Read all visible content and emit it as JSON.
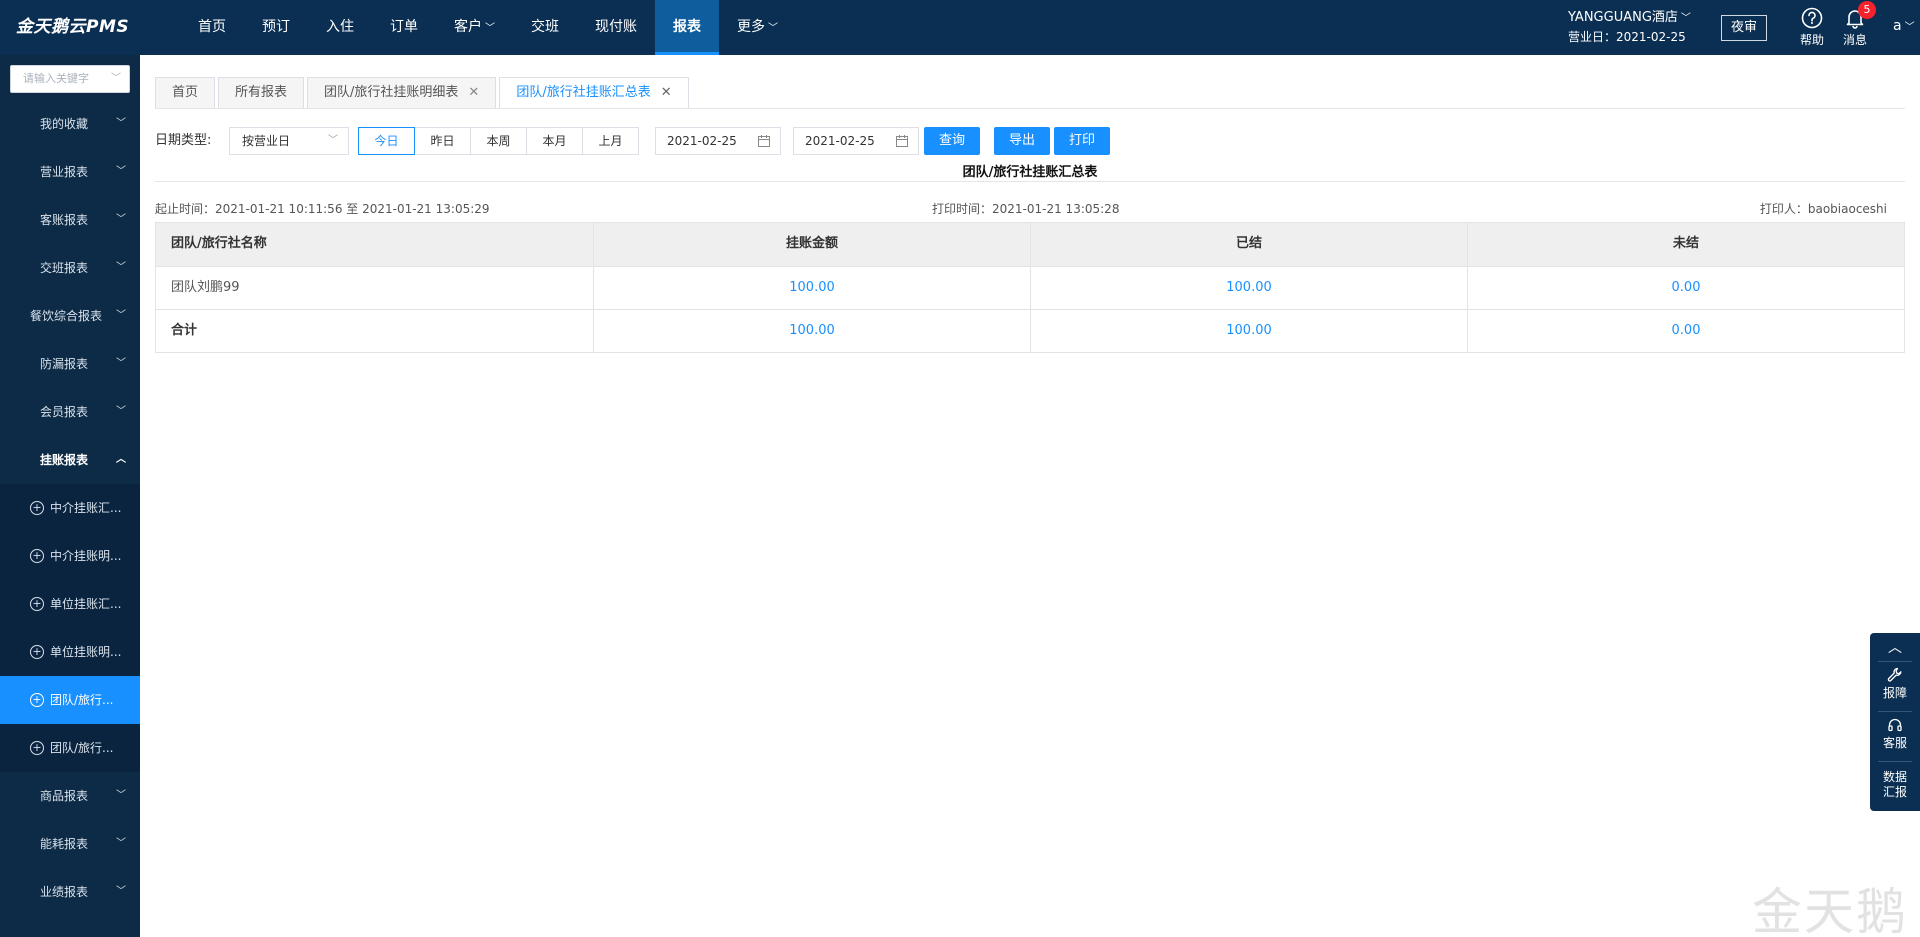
{
  "app": {
    "brand": "金天鹅云PMS"
  },
  "nav": {
    "items": [
      {
        "label": "首页",
        "has_menu": false
      },
      {
        "label": "预订",
        "has_menu": false
      },
      {
        "label": "入住",
        "has_menu": false
      },
      {
        "label": "订单",
        "has_menu": false
      },
      {
        "label": "客户",
        "has_menu": true
      },
      {
        "label": "交班",
        "has_menu": false
      },
      {
        "label": "现付账",
        "has_menu": false
      },
      {
        "label": "报表",
        "has_menu": false,
        "active": true
      },
      {
        "label": "更多",
        "has_menu": true
      }
    ]
  },
  "header": {
    "hotel_name": "YANGGUANG酒店",
    "business_date": "营业日：2021-02-25",
    "night_audit": "夜审",
    "help": "帮助",
    "messages": "消息",
    "message_count": "5",
    "user": "a"
  },
  "sidebar": {
    "search_placeholder": "请输入关键字",
    "items": [
      {
        "label": "我的收藏"
      },
      {
        "label": "营业报表"
      },
      {
        "label": "客账报表"
      },
      {
        "label": "交班报表"
      },
      {
        "label": "餐饮综合报表"
      },
      {
        "label": "防漏报表"
      },
      {
        "label": "会员报表"
      }
    ],
    "open_group": "挂账报表",
    "subitems": [
      {
        "label": "中介挂账汇..."
      },
      {
        "label": "中介挂账明..."
      },
      {
        "label": "单位挂账汇..."
      },
      {
        "label": "单位挂账明..."
      },
      {
        "label": "团队/旅行...",
        "active": true
      },
      {
        "label": "团队/旅行..."
      }
    ],
    "items_after": [
      {
        "label": "商品报表"
      },
      {
        "label": "能耗报表"
      },
      {
        "label": "业绩报表"
      }
    ]
  },
  "tabs": [
    {
      "label": "首页",
      "closable": false
    },
    {
      "label": "所有报表",
      "closable": false
    },
    {
      "label": "团队/旅行社挂账明细表",
      "closable": true
    },
    {
      "label": "团队/旅行社挂账汇总表",
      "closable": true,
      "active": true
    }
  ],
  "filters": {
    "date_type_label": "日期类型:",
    "date_type_value": "按营业日",
    "ranges": [
      "今日",
      "昨日",
      "本周",
      "本月",
      "上月"
    ],
    "active_range": "今日",
    "start_date": "2021-02-25",
    "end_date": "2021-02-25",
    "query": "查询",
    "export": "导出",
    "print": "打印"
  },
  "report": {
    "title": "团队/旅行社挂账汇总表",
    "period": "起止时间：2021-01-21 10:11:56 至 2021-01-21 13:05:29",
    "print_time": "打印时间：2021-01-21 13:05:28",
    "printer": "打印人：baobiaoceshi",
    "columns": [
      "团队/旅行社名称",
      "挂账金额",
      "已结",
      "未结"
    ],
    "rows": [
      {
        "name": "团队刘鹏99",
        "amount": "100.00",
        "settled": "100.00",
        "unsettled": "0.00"
      }
    ],
    "total": {
      "name": "合计",
      "amount": "100.00",
      "settled": "100.00",
      "unsettled": "0.00"
    }
  },
  "float_panel": {
    "items": [
      {
        "label": "报障",
        "icon": "wrench-icon"
      },
      {
        "label": "客服",
        "icon": "headset-icon"
      },
      {
        "label": "数据汇报",
        "icon": ""
      }
    ]
  },
  "watermark": "金天鹅"
}
